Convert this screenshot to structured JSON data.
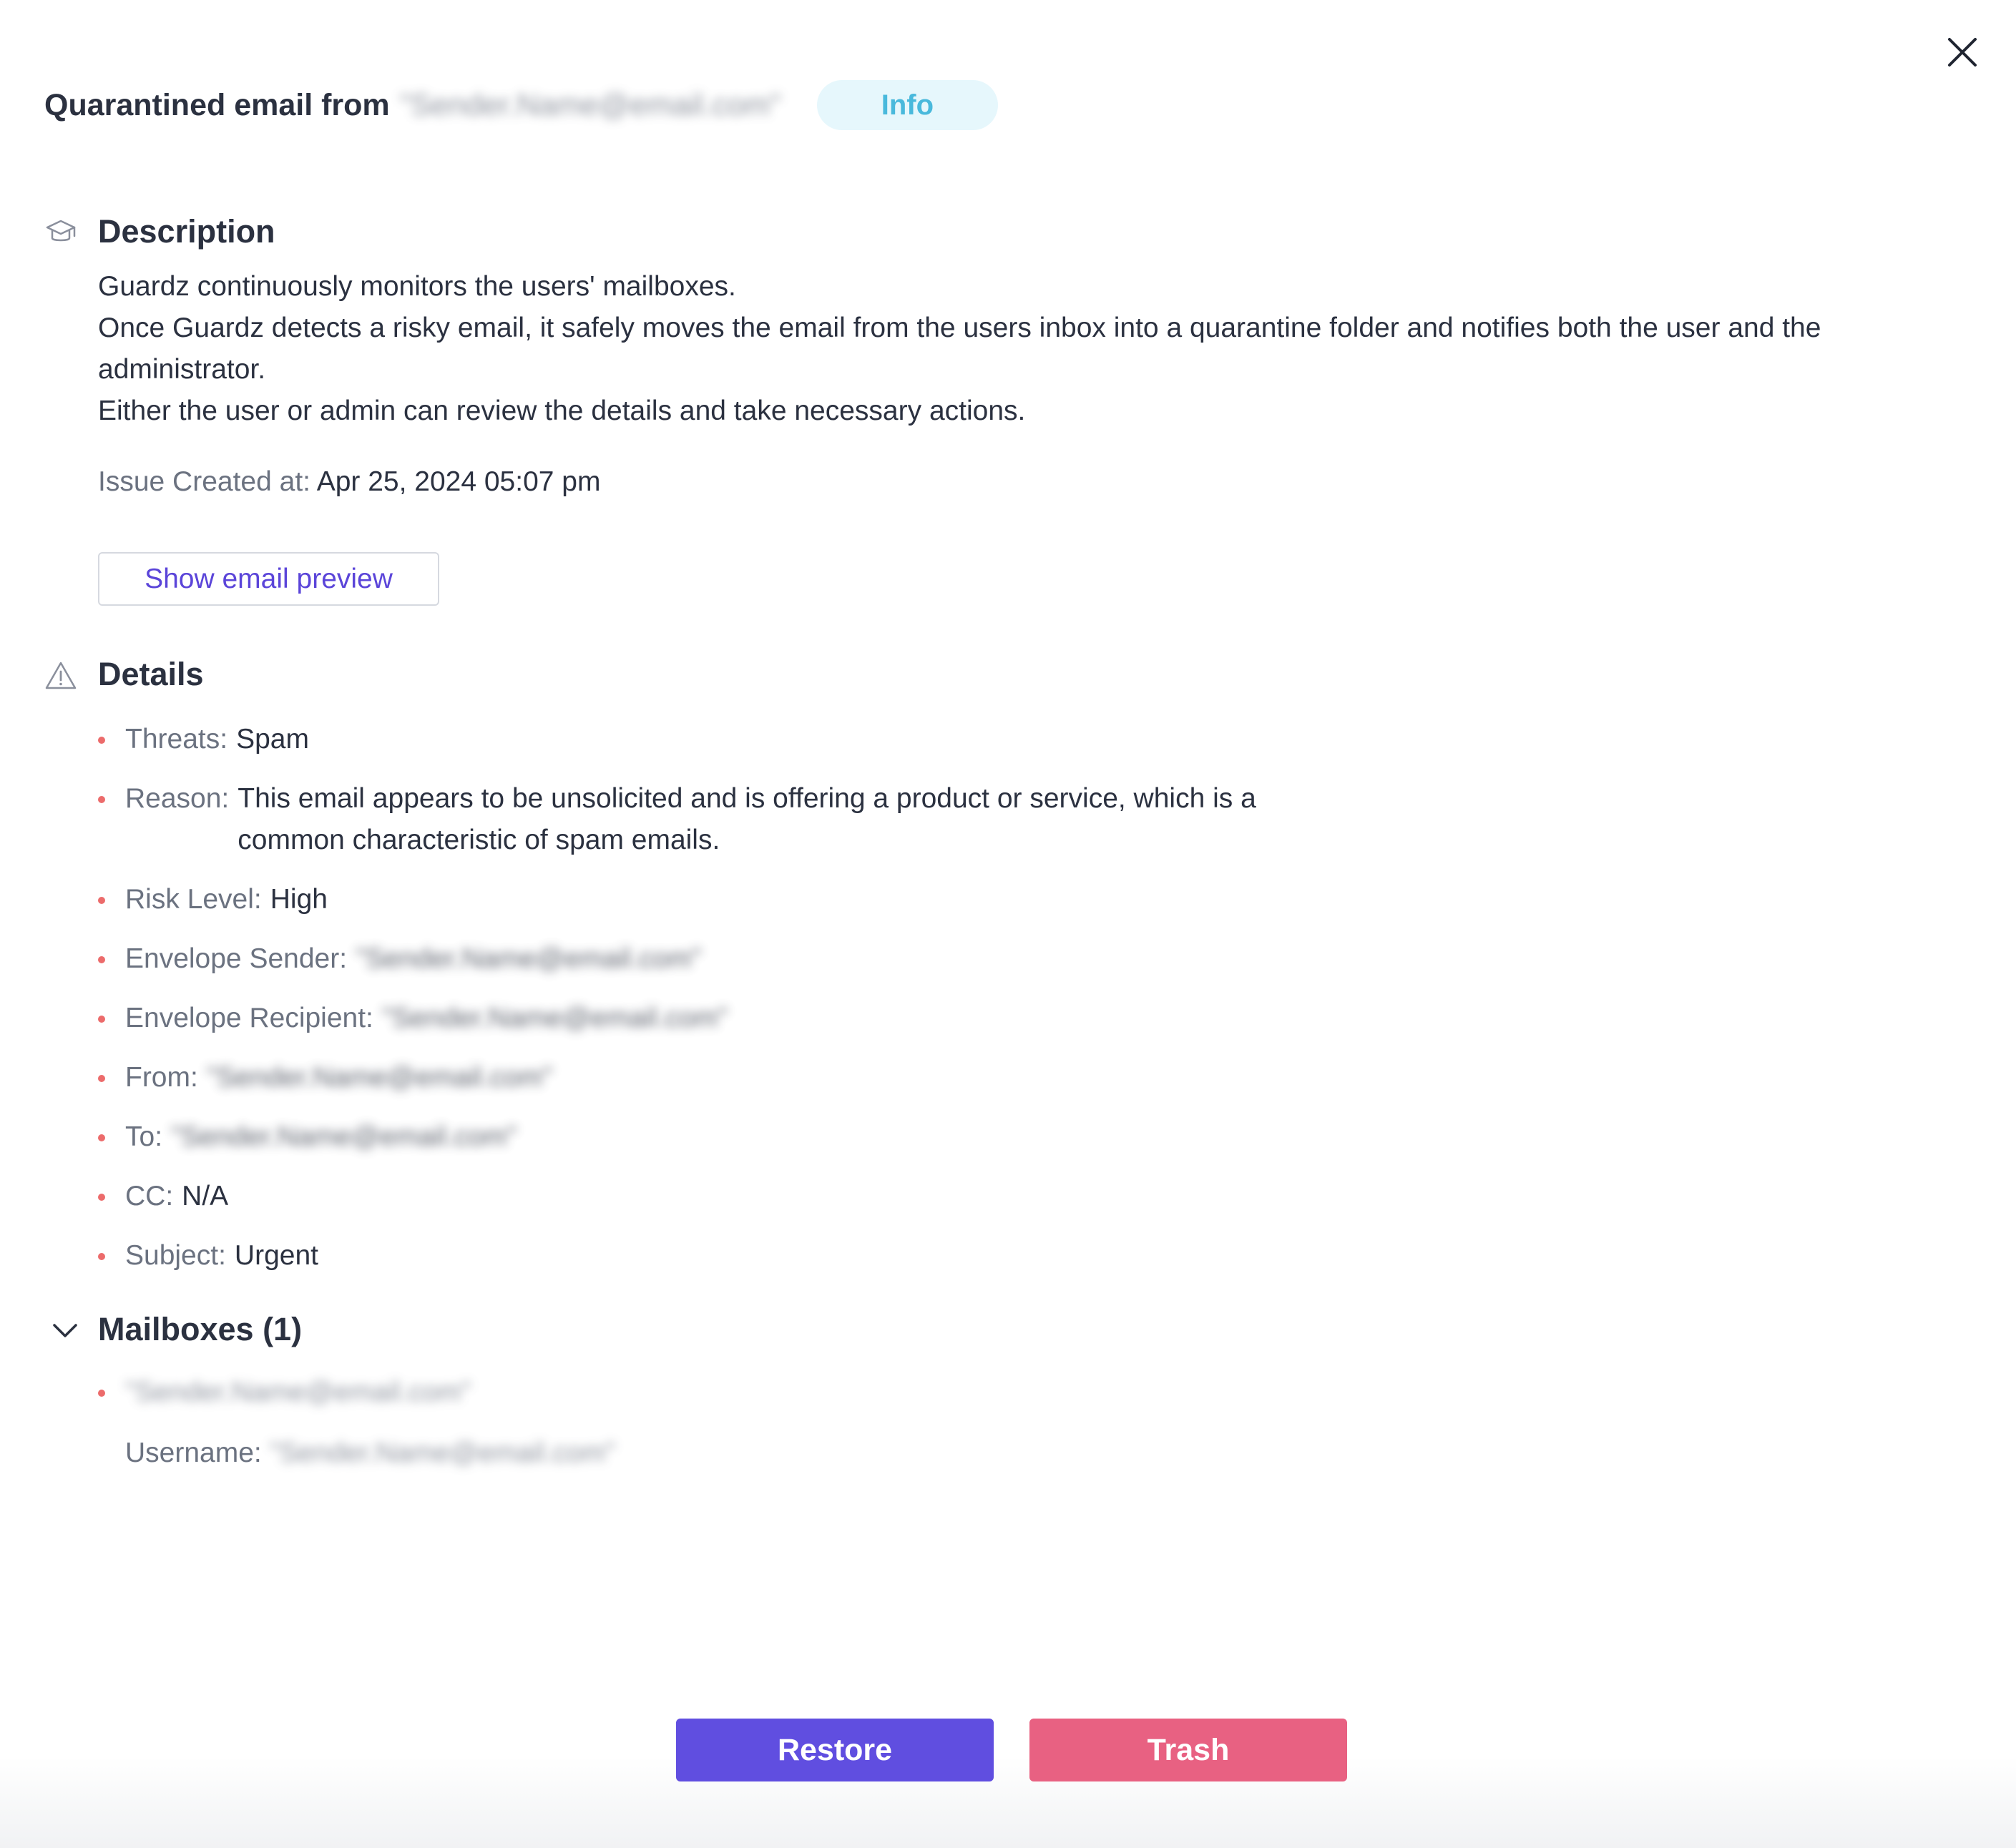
{
  "header": {
    "title": "Quarantined email from",
    "sender": "\"Sender.Name@email.com\"",
    "badge": "Info"
  },
  "description": {
    "heading": "Description",
    "lines": [
      "Guardz continuously monitors the users' mailboxes.",
      "Once Guardz detects a risky email, it safely moves the email from the users inbox into a quarantine folder and notifies both the user and the administrator.",
      "Either the user or admin can review the details and take necessary actions."
    ],
    "created_label": "Issue Created at:",
    "created_value": "Apr 25, 2024 05:07 pm",
    "preview_button": "Show email preview"
  },
  "details": {
    "heading": "Details",
    "items": [
      {
        "label": "Threats:",
        "value": "Spam"
      },
      {
        "label": "Reason:",
        "value": "This email appears to be unsolicited and is offering a product or service, which is a common characteristic of spam emails."
      },
      {
        "label": "Risk Level:",
        "value": "High"
      },
      {
        "label": "Envelope Sender:",
        "value": "\"Sender.Name@email.com\""
      },
      {
        "label": "Envelope Recipient:",
        "value": "\"Sender.Name@email.com\""
      },
      {
        "label": "From:",
        "value": "\"Sender.Name@email.com\""
      },
      {
        "label": "To:",
        "value": "\"Sender.Name@email.com\""
      },
      {
        "label": "CC:",
        "value": "N/A"
      },
      {
        "label": "Subject:",
        "value": "Urgent"
      }
    ]
  },
  "mailboxes": {
    "heading": "Mailboxes (1)",
    "item": "\"Sender.Name@email.com\"",
    "username_label": "Username:",
    "username_value": "\"Sender.Name@email.com\""
  },
  "actions": {
    "restore": "Restore",
    "trash": "Trash"
  },
  "colors": {
    "primary": "#604ee0",
    "danger": "#e86182",
    "badge_bg": "#e6f7fc",
    "badge_text": "#49b9dc",
    "bullet": "#ec6b6b",
    "link": "#5b45d9"
  }
}
